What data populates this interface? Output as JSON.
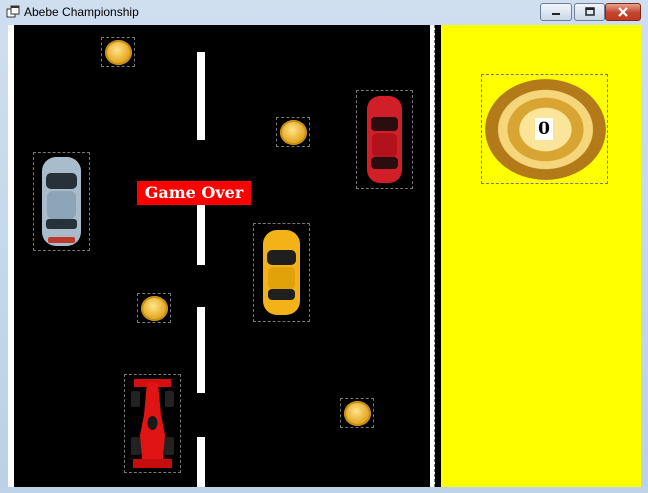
{
  "window": {
    "title": "Abebe Championship",
    "icon": "app-window-icon",
    "buttons": [
      "minimize-icon",
      "maximize-icon",
      "close-icon"
    ]
  },
  "game": {
    "status_text": "Game Over",
    "score": "0",
    "colors": {
      "road": "#000000",
      "lane": "#ffffff",
      "panel": "#ffff00",
      "status_bg": "#ff0000"
    },
    "sprites": [
      "coin",
      "coin",
      "coin",
      "coin",
      "coin",
      "silver-car",
      "red-car",
      "yellow-car",
      "race-car",
      "medal"
    ]
  }
}
